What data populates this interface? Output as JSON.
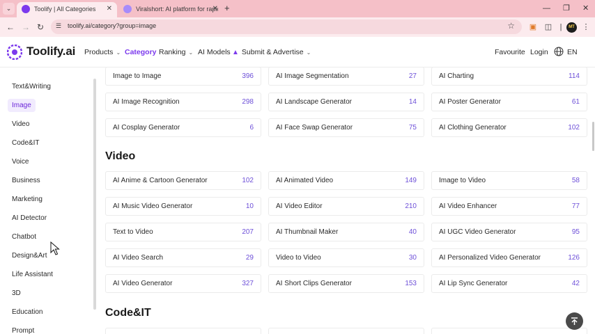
{
  "browser": {
    "tabs": [
      {
        "title": "Toolify | All Categories",
        "favicon_color": "#7c3aed"
      },
      {
        "title": "Viralshort: AI platform for rapid",
        "favicon_color": "#8b5cf6"
      }
    ],
    "new_tab_icon": "plus-icon",
    "url": "toolify.ai/category?group=image",
    "profile_initials": "MT"
  },
  "site": {
    "logo_text": "Toolify.ai",
    "nav": {
      "products": "Products",
      "category": "Category",
      "ranking": "Ranking",
      "ai_models": "AI Models",
      "submit": "Submit & Advertise"
    },
    "favourite": "Favourite",
    "login": "Login",
    "language": "EN"
  },
  "sidebar": {
    "items": [
      "Text&Writing",
      "Image",
      "Video",
      "Code&IT",
      "Voice",
      "Business",
      "Marketing",
      "AI Detector",
      "Chatbot",
      "Design&Art",
      "Life Assistant",
      "3D",
      "Education",
      "Prompt"
    ],
    "active": "Image"
  },
  "image_cards": [
    {
      "name": "Image to Image",
      "count": "396"
    },
    {
      "name": "AI Image Segmentation",
      "count": "27"
    },
    {
      "name": "AI Charting",
      "count": "114"
    },
    {
      "name": "AI Image Recognition",
      "count": "298"
    },
    {
      "name": "AI Landscape Generator",
      "count": "14"
    },
    {
      "name": "AI Poster Generator",
      "count": "61"
    },
    {
      "name": "AI Cosplay Generator",
      "count": "6"
    },
    {
      "name": "AI Face Swap Generator",
      "count": "75"
    },
    {
      "name": "AI Clothing Generator",
      "count": "102"
    }
  ],
  "video_section": {
    "title": "Video",
    "cards": [
      {
        "name": "AI Anime & Cartoon Generator",
        "count": "102"
      },
      {
        "name": "AI Animated Video",
        "count": "149"
      },
      {
        "name": "Image to Video",
        "count": "58"
      },
      {
        "name": "AI Music Video Generator",
        "count": "10"
      },
      {
        "name": "AI Video Editor",
        "count": "210"
      },
      {
        "name": "AI Video Enhancer",
        "count": "77"
      },
      {
        "name": "Text to Video",
        "count": "207"
      },
      {
        "name": "AI Thumbnail Maker",
        "count": "40"
      },
      {
        "name": "AI UGC Video Generator",
        "count": "95"
      },
      {
        "name": "AI Video Search",
        "count": "29"
      },
      {
        "name": "Video to Video",
        "count": "30"
      },
      {
        "name": "AI Personalized Video Generator",
        "count": "126"
      },
      {
        "name": "AI Video Generator",
        "count": "327"
      },
      {
        "name": "AI Short Clips Generator",
        "count": "153"
      },
      {
        "name": "AI Lip Sync Generator",
        "count": "42"
      }
    ]
  },
  "codeit_section": {
    "title": "Code&IT"
  },
  "colors": {
    "accent": "#7c3aed",
    "count": "#6d4fd8",
    "tab_bar": "#f5c0c8"
  }
}
